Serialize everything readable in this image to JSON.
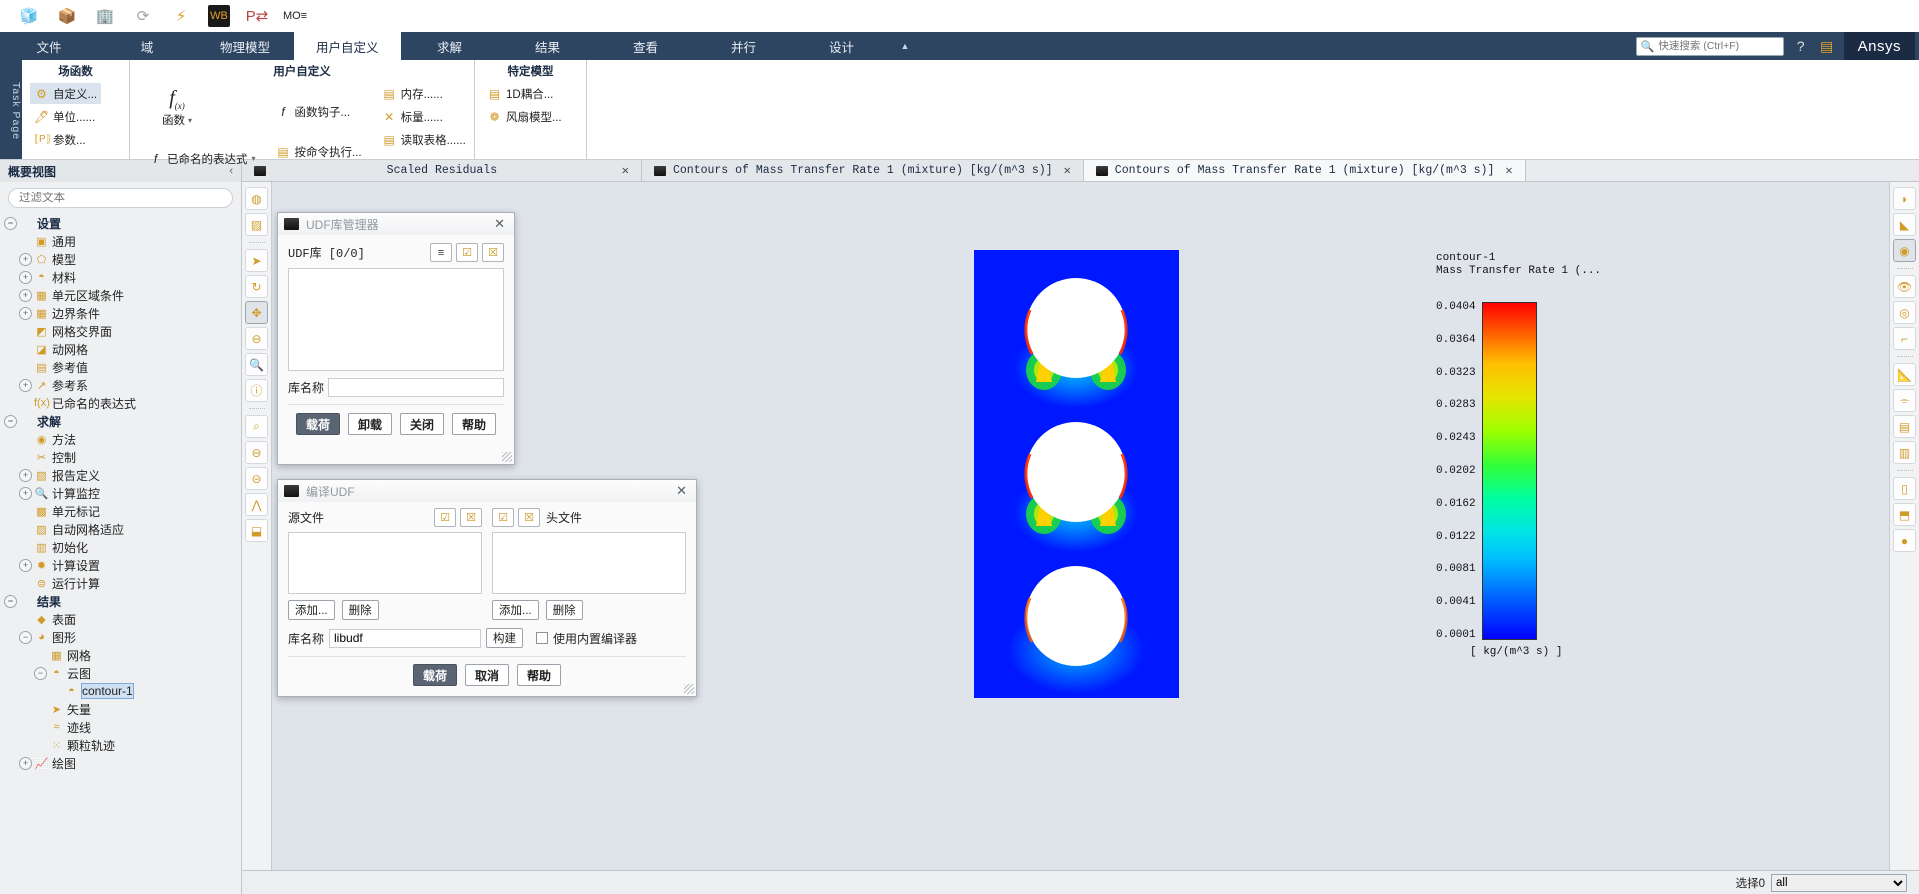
{
  "quick_access": {
    "icons": [
      "mesh-cube-icon",
      "import-icon",
      "save-building-icon",
      "refresh-icon",
      "lightning-icon",
      "workbench-icon",
      "p2p-icon",
      "mo-icon"
    ]
  },
  "ribbon": {
    "tabs": [
      {
        "label": "文件",
        "active": false
      },
      {
        "label": "域",
        "active": false
      },
      {
        "label": "物理模型",
        "active": false
      },
      {
        "label": "用户自定义",
        "active": true
      },
      {
        "label": "求解",
        "active": false
      },
      {
        "label": "结果",
        "active": false
      },
      {
        "label": "查看",
        "active": false
      },
      {
        "label": "并行",
        "active": false
      },
      {
        "label": "设计",
        "active": false
      }
    ],
    "collapse_caret": "▲",
    "search_placeholder": "快速搜索 (Ctrl+F)",
    "search_value": "",
    "help_icon": "?",
    "panel_icon": "▤",
    "brand": "Ansys",
    "task_page_rail": "Task Page",
    "groups": [
      {
        "title": "场函数",
        "items": [
          {
            "label": "自定义...",
            "icon": "⚙",
            "selected": true
          },
          {
            "label": "单位......",
            "icon": "▯",
            "selected": false
          },
          {
            "label": "参数...",
            "icon": "⟦P⟧",
            "selected": false
          }
        ]
      },
      {
        "title": "用户自定义",
        "big": [
          {
            "label": "函数",
            "icon": "f(x)",
            "caret": "▾"
          }
        ],
        "cols": [
          [
            {
              "label": "已命名的表达式",
              "icon": "f(x)",
              "caret": "▾"
            }
          ],
          [
            {
              "label": "函数钩子...",
              "icon": "f(x)"
            },
            {
              "label": "按命令执行...",
              "icon": "▤"
            }
          ],
          [
            {
              "label": "内存......",
              "icon": "▤"
            },
            {
              "label": "标量......",
              "icon": "✕"
            },
            {
              "label": "读取表格......",
              "icon": "▤"
            }
          ]
        ]
      },
      {
        "title": "特定模型",
        "items": [
          {
            "label": "1D耦合...",
            "icon": "▤"
          },
          {
            "label": "风扇模型...",
            "icon": "❁"
          }
        ]
      }
    ]
  },
  "outline": {
    "header": "概要视图",
    "collapse_chevron": "‹",
    "filter_placeholder": "过滤文本",
    "filter_value": "",
    "tree": [
      {
        "label": "设置",
        "depth": 0,
        "toggle": "−",
        "icon": "",
        "root": true
      },
      {
        "label": "通用",
        "depth": 1,
        "toggle": "",
        "icon": "▣"
      },
      {
        "label": "模型",
        "depth": 1,
        "toggle": "+",
        "icon": "⬠"
      },
      {
        "label": "材料",
        "depth": 1,
        "toggle": "+",
        "icon": "◓"
      },
      {
        "label": "单元区域条件",
        "depth": 1,
        "toggle": "+",
        "icon": "▦"
      },
      {
        "label": "边界条件",
        "depth": 1,
        "toggle": "+",
        "icon": "▦"
      },
      {
        "label": "网格交界面",
        "depth": 1,
        "toggle": "",
        "icon": "◩"
      },
      {
        "label": "动网格",
        "depth": 1,
        "toggle": "",
        "icon": "◪"
      },
      {
        "label": "参考值",
        "depth": 1,
        "toggle": "",
        "icon": "▤"
      },
      {
        "label": "参考系",
        "depth": 1,
        "toggle": "+",
        "icon": "↗"
      },
      {
        "label": "已命名的表达式",
        "depth": 1,
        "toggle": "",
        "icon": "f(x)"
      },
      {
        "label": "求解",
        "depth": 0,
        "toggle": "−",
        "icon": "",
        "root": true
      },
      {
        "label": "方法",
        "depth": 1,
        "toggle": "",
        "icon": "◉"
      },
      {
        "label": "控制",
        "depth": 1,
        "toggle": "",
        "icon": "✂"
      },
      {
        "label": "报告定义",
        "depth": 1,
        "toggle": "+",
        "icon": "▧"
      },
      {
        "label": "计算监控",
        "depth": 1,
        "toggle": "+",
        "icon": "🔍"
      },
      {
        "label": "单元标记",
        "depth": 1,
        "toggle": "",
        "icon": "▩"
      },
      {
        "label": "自动网格适应",
        "depth": 1,
        "toggle": "",
        "icon": "▨"
      },
      {
        "label": "初始化",
        "depth": 1,
        "toggle": "",
        "icon": "▥"
      },
      {
        "label": "计算设置",
        "depth": 1,
        "toggle": "+",
        "icon": "✹"
      },
      {
        "label": "运行计算",
        "depth": 1,
        "toggle": "",
        "icon": "⊜"
      },
      {
        "label": "结果",
        "depth": 0,
        "toggle": "−",
        "icon": "",
        "root": true
      },
      {
        "label": "表面",
        "depth": 1,
        "toggle": "",
        "icon": "◆"
      },
      {
        "label": "图形",
        "depth": 1,
        "toggle": "−",
        "icon": "◕"
      },
      {
        "label": "网格",
        "depth": 2,
        "toggle": "",
        "icon": "▦"
      },
      {
        "label": "云图",
        "depth": 2,
        "toggle": "−",
        "icon": "◓"
      },
      {
        "label": "contour-1",
        "depth": 3,
        "toggle": "",
        "icon": "◓",
        "selected": true
      },
      {
        "label": "矢量",
        "depth": 2,
        "toggle": "",
        "icon": "➤"
      },
      {
        "label": "迹线",
        "depth": 2,
        "toggle": "",
        "icon": "≈"
      },
      {
        "label": "颗粒轨迹",
        "depth": 2,
        "toggle": "",
        "icon": "⁙"
      },
      {
        "label": "绘图",
        "depth": 1,
        "toggle": "+",
        "icon": "📈"
      }
    ]
  },
  "graphics_tabs": [
    {
      "label": "Scaled Residuals",
      "active": false,
      "closable": true
    },
    {
      "label": "Contours of Mass Transfer Rate 1 (mixture)  [kg/(m^3 s)]",
      "active": false,
      "closable": true
    },
    {
      "label": "Contours of Mass Transfer Rate 1 (mixture)  [kg/(m^3 s)]",
      "active": true,
      "closable": true
    }
  ],
  "left_toolbar": [
    {
      "icon": "◍",
      "name": "mesh-display-icon",
      "active": false
    },
    {
      "icon": "▨",
      "name": "surface-display-icon",
      "active": false
    },
    {
      "sep": true
    },
    {
      "icon": "➤",
      "name": "select-pointer-icon",
      "active": false
    },
    {
      "icon": "↻",
      "name": "rotate-icon",
      "active": false
    },
    {
      "icon": "✥",
      "name": "pan-icon",
      "active": true
    },
    {
      "icon": "⊖",
      "name": "zoom-window-icon",
      "active": false
    },
    {
      "icon": "🔍",
      "name": "zoom-icon",
      "active": false
    },
    {
      "icon": "ⓘ",
      "name": "probe-info-icon",
      "active": false
    },
    {
      "sep": true
    },
    {
      "icon": "⌕",
      "name": "zoom-fit-icon",
      "active": false
    },
    {
      "icon": "⊖",
      "name": "zoom-out-icon",
      "active": false
    },
    {
      "icon": "⊝",
      "name": "zoom-in-icon",
      "active": false
    },
    {
      "icon": "⋀",
      "name": "axes-triad-icon",
      "active": false
    },
    {
      "icon": "⬓",
      "name": "view-cube-icon",
      "active": false
    }
  ],
  "right_toolbar": [
    {
      "icon": "◗",
      "name": "colormap-icon"
    },
    {
      "icon": "◣",
      "name": "ruler-icon"
    },
    {
      "icon": "◉",
      "name": "lighting-icon",
      "active": true
    },
    {
      "sep": true
    },
    {
      "icon": "👁",
      "name": "visibility-icon"
    },
    {
      "icon": "◎",
      "name": "display-options-icon"
    },
    {
      "icon": "⌐",
      "name": "annotate-icon"
    },
    {
      "sep": true
    },
    {
      "icon": "📐",
      "name": "measure-icon"
    },
    {
      "icon": "⌯",
      "name": "line-tool-icon"
    },
    {
      "icon": "▤",
      "name": "list-icon"
    },
    {
      "icon": "▥",
      "name": "grid-icon"
    },
    {
      "sep": true
    },
    {
      "icon": "▯",
      "name": "copy-view-icon"
    },
    {
      "icon": "⬒",
      "name": "scene-icon"
    },
    {
      "icon": "●",
      "name": "render-icon"
    }
  ],
  "contour": {
    "legend_title_line1": "contour-1",
    "legend_title_line2": "Mass Transfer Rate 1 (...",
    "ticks": [
      "0.0404",
      "0.0364",
      "0.0323",
      "0.0283",
      "0.0243",
      "0.0202",
      "0.0162",
      "0.0122",
      "0.0081",
      "0.0041",
      "0.0001"
    ],
    "unit": "[ kg/(m^3 s) ]",
    "max": 0.0404,
    "min": 0.0001
  },
  "bottom_bar": {
    "select_label": "选择0",
    "select_value": "all",
    "select_options": [
      "all"
    ]
  },
  "udf_manager_dialog": {
    "title": "UDF库管理器",
    "close": "✕",
    "lib_label": "UDF库 [0/0]",
    "list_items": [],
    "tool_buttons": [
      "≡",
      "☑",
      "☒"
    ],
    "name_label": "库名称",
    "name_value": "",
    "buttons": [
      {
        "label": "载荷",
        "primary": true
      },
      {
        "label": "卸载",
        "primary": false
      },
      {
        "label": "关闭",
        "primary": false
      },
      {
        "label": "帮助",
        "primary": false
      }
    ]
  },
  "compile_udf_dialog": {
    "title": "编译UDF",
    "close": "✕",
    "source_label": "源文件",
    "header_label": "头文件",
    "source_items": [],
    "header_items": [],
    "source_tools": [
      "☑",
      "☒"
    ],
    "header_tools": [
      "☑",
      "☒"
    ],
    "source_buttons": [
      {
        "label": "添加..."
      },
      {
        "label": "删除"
      }
    ],
    "header_buttons": [
      {
        "label": "添加..."
      },
      {
        "label": "删除"
      }
    ],
    "libname_label": "库名称",
    "libname_value": "libudf",
    "build_label": "构建",
    "builtin_compiler_label": "使用内置编译器",
    "builtin_compiler_checked": false,
    "buttons": [
      {
        "label": "载荷",
        "primary": true
      },
      {
        "label": "取消",
        "primary": false
      },
      {
        "label": "帮助",
        "primary": false
      }
    ]
  }
}
